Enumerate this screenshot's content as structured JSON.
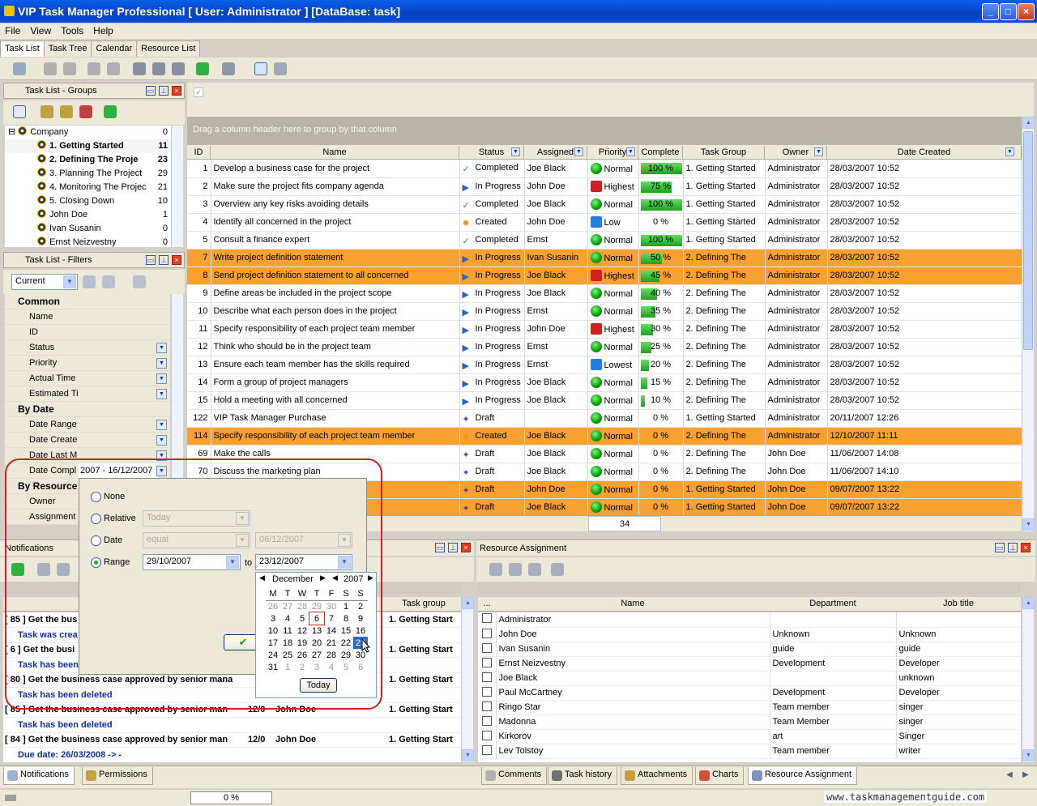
{
  "window": {
    "title": "VIP Task Manager Professional [ User: Administrator ] [DataBase: task]"
  },
  "menu": [
    "File",
    "View",
    "Tools",
    "Help"
  ],
  "top_tabs": [
    "Task List",
    "Task Tree",
    "Calendar",
    "Resource List"
  ],
  "groups_panel": {
    "title": "Task List - Groups",
    "items": [
      {
        "label": "Company",
        "count": "0"
      },
      {
        "label": "1. Getting Started",
        "count": "11"
      },
      {
        "label": "2. Defining The Proje",
        "count": "23"
      },
      {
        "label": "3. Planning The Project",
        "count": "29"
      },
      {
        "label": "4. Monitoring The Projec",
        "count": "21"
      },
      {
        "label": "5. Closing Down",
        "count": "10"
      },
      {
        "label": "John Doe",
        "count": "1"
      },
      {
        "label": "Ivan Susanin",
        "count": "0"
      },
      {
        "label": "Ernst Neizvestny",
        "count": "0"
      }
    ]
  },
  "filters_panel": {
    "title": "Task List - Filters",
    "current": "Current",
    "sections": {
      "common": "Common",
      "by_date": "By Date",
      "by_resource": "By Resource"
    },
    "common_rows": [
      "Name",
      "ID",
      "Status",
      "Priority",
      "Actual Time",
      "Estimated Ti"
    ],
    "date_rows": [
      "Date Range",
      "Date Create",
      "Date Last M",
      "Date Compl"
    ],
    "date_compl_value": "2007 - 16/12/2007",
    "resource_rows": [
      "Owner",
      "Assignment"
    ]
  },
  "grid": {
    "group_hint": "Drag a column header here to group by that column",
    "columns": [
      "ID",
      "Name",
      "Status",
      "Assigned",
      "Priority",
      "Complete",
      "Task Group",
      "Owner",
      "Date Created"
    ],
    "footer_count": "34",
    "rows": [
      {
        "id": "1",
        "name": "Develop a business case for the project",
        "status": "Completed",
        "assigned": "Joe Black",
        "priority": "Normal",
        "complete": "100 %",
        "pct": 100,
        "group": "1. Getting Started",
        "owner": "Administrator",
        "date": "28/03/2007 10:52",
        "hl": false,
        "st": "done",
        "pr": "n"
      },
      {
        "id": "2",
        "name": "Make sure the project fits company agenda",
        "status": "In Progress",
        "assigned": "John Doe",
        "priority": "Highest",
        "complete": "75 %",
        "pct": 75,
        "group": "1. Getting Started",
        "owner": "Administrator",
        "date": "28/03/2007 10:52",
        "hl": false,
        "st": "prog",
        "pr": "h"
      },
      {
        "id": "3",
        "name": "Overview any key risks avoiding details",
        "status": "Completed",
        "assigned": "Joe Black",
        "priority": "Normal",
        "complete": "100 %",
        "pct": 100,
        "group": "1. Getting Started",
        "owner": "Administrator",
        "date": "28/03/2007 10:52",
        "hl": false,
        "st": "done",
        "pr": "n"
      },
      {
        "id": "4",
        "name": "Identify all concerned in the project",
        "status": "Created",
        "assigned": "John Doe",
        "priority": "Low",
        "complete": "0 %",
        "pct": 0,
        "group": "1. Getting Started",
        "owner": "Administrator",
        "date": "28/03/2007 10:52",
        "hl": false,
        "st": "new",
        "pr": "l"
      },
      {
        "id": "5",
        "name": "Consult a finance expert",
        "status": "Completed",
        "assigned": "Ernst",
        "priority": "Normal",
        "complete": "100 %",
        "pct": 100,
        "group": "1. Getting Started",
        "owner": "Administrator",
        "date": "28/03/2007 10:52",
        "hl": false,
        "st": "done",
        "pr": "n"
      },
      {
        "id": "7",
        "name": "Write project definition statement",
        "status": "In Progress",
        "assigned": "Ivan Susanin",
        "priority": "Normal",
        "complete": "50 %",
        "pct": 50,
        "group": "2. Defining The",
        "owner": "Administrator",
        "date": "28/03/2007 10:52",
        "hl": true,
        "st": "prog",
        "pr": "n"
      },
      {
        "id": "8",
        "name": "Send project definition statement to all concerned",
        "status": "In Progress",
        "assigned": "Joe Black",
        "priority": "Highest",
        "complete": "45 %",
        "pct": 45,
        "group": "2. Defining The",
        "owner": "Administrator",
        "date": "28/03/2007 10:52",
        "hl": true,
        "st": "prog",
        "pr": "h"
      },
      {
        "id": "9",
        "name": "Define areas be included in the project scope",
        "status": "In Progress",
        "assigned": "Joe Black",
        "priority": "Normal",
        "complete": "40 %",
        "pct": 40,
        "group": "2. Defining The",
        "owner": "Administrator",
        "date": "28/03/2007 10:52",
        "hl": false,
        "st": "prog",
        "pr": "n"
      },
      {
        "id": "10",
        "name": "Describe what each person does in the project",
        "status": "In Progress",
        "assigned": "Ernst",
        "priority": "Normal",
        "complete": "35 %",
        "pct": 35,
        "group": "2. Defining The",
        "owner": "Administrator",
        "date": "28/03/2007 10:52",
        "hl": false,
        "st": "prog",
        "pr": "n"
      },
      {
        "id": "11",
        "name": "Specify responsibility of each project team member",
        "status": "In Progress",
        "assigned": "John Doe",
        "priority": "Highest",
        "complete": "30 %",
        "pct": 30,
        "group": "2. Defining The",
        "owner": "Administrator",
        "date": "28/03/2007 10:52",
        "hl": false,
        "st": "prog",
        "pr": "h"
      },
      {
        "id": "12",
        "name": "Think who should be in the project team",
        "status": "In Progress",
        "assigned": "Ernst",
        "priority": "Normal",
        "complete": "25 %",
        "pct": 25,
        "group": "2. Defining The",
        "owner": "Administrator",
        "date": "28/03/2007 10:52",
        "hl": false,
        "st": "prog",
        "pr": "n"
      },
      {
        "id": "13",
        "name": "Ensure each team member has the skills required",
        "status": "In Progress",
        "assigned": "Ernst",
        "priority": "Lowest",
        "complete": "20 %",
        "pct": 20,
        "group": "2. Defining The",
        "owner": "Administrator",
        "date": "28/03/2007 10:52",
        "hl": false,
        "st": "prog",
        "pr": "l"
      },
      {
        "id": "14",
        "name": "Form a group of project managers",
        "status": "In Progress",
        "assigned": "Joe Black",
        "priority": "Normal",
        "complete": "15 %",
        "pct": 15,
        "group": "2. Defining The",
        "owner": "Administrator",
        "date": "28/03/2007 10:52",
        "hl": false,
        "st": "prog",
        "pr": "n"
      },
      {
        "id": "15",
        "name": "Hold a meeting with all concerned",
        "status": "In Progress",
        "assigned": "Joe Black",
        "priority": "Normal",
        "complete": "10 %",
        "pct": 10,
        "group": "2. Defining The",
        "owner": "Administrator",
        "date": "28/03/2007 10:52",
        "hl": false,
        "st": "prog",
        "pr": "n"
      },
      {
        "id": "122",
        "name": "VIP Task Manager Purchase",
        "status": "Draft",
        "assigned": "",
        "priority": "Normal",
        "complete": "0 %",
        "pct": 0,
        "group": "1. Getting Started",
        "owner": "Administrator",
        "date": "20/11/2007 12:26",
        "hl": false,
        "st": "draft",
        "pr": "n"
      },
      {
        "id": "114",
        "name": "Specify responsibility of each project team member",
        "status": "Created",
        "assigned": "Joe Black",
        "priority": "Normal",
        "complete": "0 %",
        "pct": 0,
        "group": "2. Defining The",
        "owner": "Administrator",
        "date": "12/10/2007 11:11",
        "hl": true,
        "st": "new",
        "pr": "n"
      },
      {
        "id": "69",
        "name": "Make the calls",
        "status": "Draft",
        "assigned": "Joe Black",
        "priority": "Normal",
        "complete": "0 %",
        "pct": 0,
        "group": "2. Defining The",
        "owner": "John Doe",
        "date": "11/06/2007 14:08",
        "hl": false,
        "st": "draft",
        "pr": "n"
      },
      {
        "id": "70",
        "name": "Discuss the marketing plan",
        "status": "Draft",
        "assigned": "Joe Black",
        "priority": "Normal",
        "complete": "0 %",
        "pct": 0,
        "group": "2. Defining The",
        "owner": "John Doe",
        "date": "11/06/2007 14:10",
        "hl": false,
        "st": "draft",
        "pr": "n"
      },
      {
        "id": "",
        "name": "",
        "status": "Draft",
        "assigned": "John Doe",
        "priority": "Normal",
        "complete": "0 %",
        "pct": 0,
        "group": "1. Getting Started",
        "owner": "John Doe",
        "date": "09/07/2007 13:22",
        "hl": true,
        "st": "draft",
        "pr": "n"
      },
      {
        "id": "",
        "name": "",
        "status": "Draft",
        "assigned": "Joe Black",
        "priority": "Normal",
        "complete": "0 %",
        "pct": 0,
        "group": "1. Getting Started",
        "owner": "John Doe",
        "date": "09/07/2007 13:22",
        "hl": true,
        "st": "draft",
        "pr": "n"
      }
    ]
  },
  "date_popup": {
    "none": "None",
    "relative": "Relative",
    "relative_value": "Today",
    "date": "Date",
    "date_op": "equal",
    "date_value": "06/12/2007",
    "range": "Range",
    "range_from": "29/10/2007",
    "to": "to",
    "range_to": "23/12/2007"
  },
  "calendar": {
    "month": "December",
    "year": "2007",
    "weekdays": [
      "M",
      "T",
      "W",
      "T",
      "F",
      "S",
      "S"
    ],
    "weeks": [
      [
        "26",
        "27",
        "28",
        "29",
        "30",
        "1",
        "2"
      ],
      [
        "3",
        "4",
        "5",
        "6",
        "7",
        "8",
        "9"
      ],
      [
        "10",
        "11",
        "12",
        "13",
        "14",
        "15",
        "16"
      ],
      [
        "17",
        "18",
        "19",
        "20",
        "21",
        "22",
        "23"
      ],
      [
        "24",
        "25",
        "26",
        "27",
        "28",
        "29",
        "30"
      ],
      [
        "31",
        "1",
        "2",
        "3",
        "4",
        "5",
        "6"
      ]
    ],
    "today_label": "Today",
    "selected": "23",
    "today": "6"
  },
  "notifications": {
    "title": "Notifications",
    "col_group": "Task group",
    "rows": [
      {
        "type": "h",
        "text": "[ 85 ] Get the bus",
        "group": "1. Getting Start"
      },
      {
        "type": "s",
        "text": "Task was crea"
      },
      {
        "type": "h",
        "text": "[ 6 ] Get the busi",
        "group": "1. Getting Start"
      },
      {
        "type": "s",
        "text": "Task has been deleted"
      },
      {
        "type": "h",
        "text": "[ 80 ] Get the business case approved by senior mana",
        "group": "1. Getting Start"
      },
      {
        "type": "s",
        "text": "Task has been deleted"
      },
      {
        "type": "h",
        "text": "[ 85 ] Get the business case approved by senior man",
        "date": "12/0",
        "who": "John Doe",
        "group": "1. Getting Start"
      },
      {
        "type": "s",
        "text": "Task has been deleted"
      },
      {
        "type": "h",
        "text": "[ 84 ] Get the business case approved by senior man",
        "date": "12/0",
        "who": "John Doe",
        "group": "1. Getting Start"
      },
      {
        "type": "s",
        "text": "Due date: 26/03/2008 -> -"
      }
    ]
  },
  "resource": {
    "title": "Resource Assignment",
    "columns": [
      "...",
      "Name",
      "Department",
      "Job title"
    ],
    "rows": [
      {
        "name": "Administrator",
        "dept": "",
        "job": ""
      },
      {
        "name": "John Doe",
        "dept": "Unknown",
        "job": "Unknown"
      },
      {
        "name": "Ivan Susanin",
        "dept": "guide",
        "job": "guide"
      },
      {
        "name": "Ernst Neizvestny",
        "dept": "Development",
        "job": "Developer"
      },
      {
        "name": "Joe Black",
        "dept": "",
        "job": "unknown"
      },
      {
        "name": "Paul McCartney",
        "dept": "Development",
        "job": "Developer"
      },
      {
        "name": "Ringo Star",
        "dept": "Team member",
        "job": "singer"
      },
      {
        "name": "Madonna",
        "dept": "Team Member",
        "job": "singer"
      },
      {
        "name": "Kirkorov",
        "dept": "art",
        "job": "Singer"
      },
      {
        "name": "Lev Tolstoy",
        "dept": "Team member",
        "job": "writer"
      }
    ]
  },
  "bottom_tabs_left": [
    "Notifications",
    "Permissions"
  ],
  "bottom_tabs_right": [
    "Comments",
    "Task history",
    "Attachments",
    "Charts",
    "Resource Assignment"
  ],
  "status": {
    "progress": "0 %"
  },
  "watermark": "www.taskmanagementguide.com",
  "colors": {
    "highlight": "#f8a030",
    "title_blue": "#0a5fe8",
    "annotation_red": "#d02020"
  }
}
